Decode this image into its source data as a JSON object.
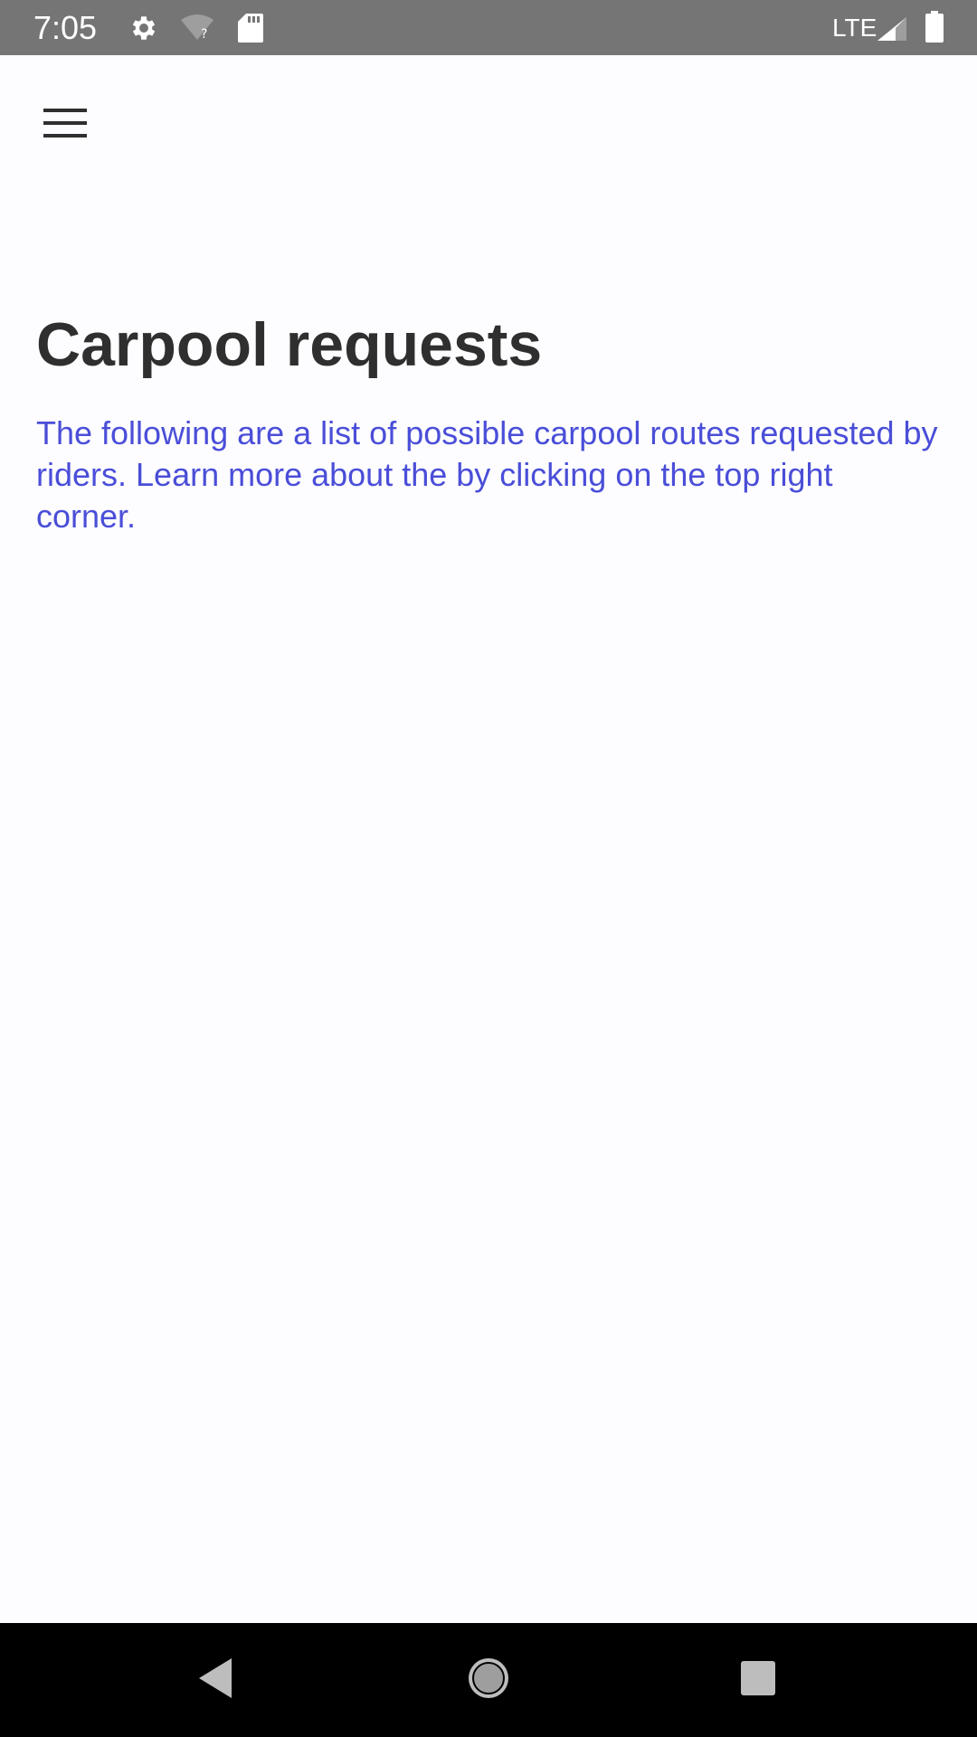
{
  "status_bar": {
    "time": "7:05",
    "network": "LTE",
    "icons": [
      "gear-icon",
      "wifi-icon",
      "sd-card-icon",
      "signal-icon",
      "battery-icon"
    ]
  },
  "app_bar": {
    "menu_icon": "hamburger-menu-icon"
  },
  "content": {
    "title": "Carpool requests",
    "description": "The following are a list of possible carpool routes requested by riders. Learn more about the by clicking on the top right corner."
  },
  "nav_bar": {
    "icons": [
      "back-icon",
      "home-icon",
      "recents-icon"
    ]
  },
  "colors": {
    "status_bar": "#757575",
    "background": "#fdfdff",
    "title": "#2f2f2f",
    "description": "#4a4ed8",
    "nav_bar": "#000000"
  }
}
